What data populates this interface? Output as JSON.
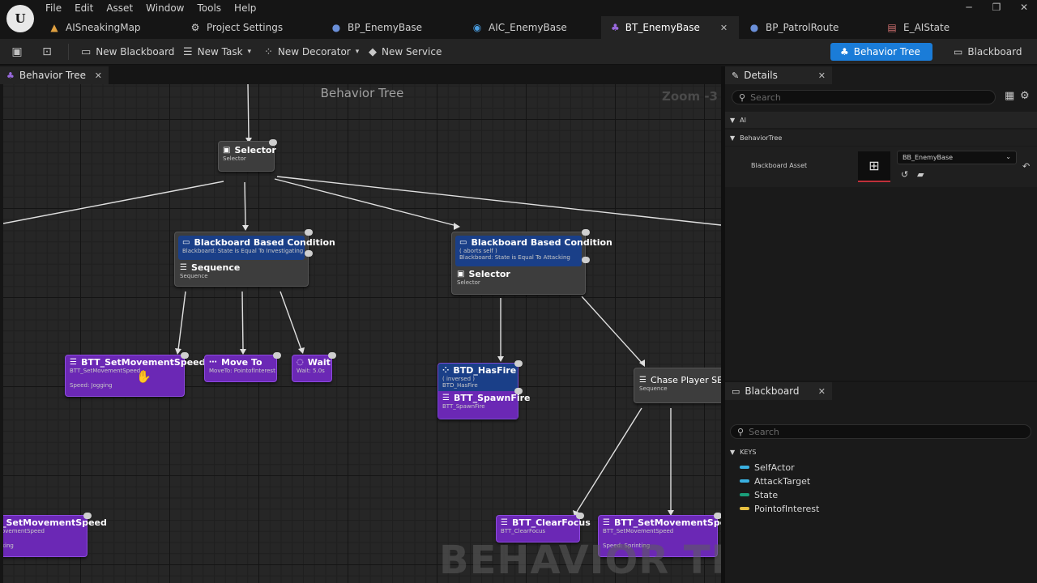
{
  "menu": [
    "File",
    "Edit",
    "Asset",
    "Window",
    "Tools",
    "Help"
  ],
  "tabs": [
    {
      "label": "AISneakingMap",
      "icon": "level-icon",
      "color": "#e0a040"
    },
    {
      "label": "Project Settings",
      "icon": "gear-icon",
      "color": "#c8c8c8"
    },
    {
      "label": "BP_EnemyBase",
      "icon": "person-icon",
      "color": "#6a8fd8"
    },
    {
      "label": "AIC_EnemyBase",
      "icon": "ai-controller-icon",
      "color": "#4a9de0"
    },
    {
      "label": "BT_EnemyBase",
      "icon": "behavior-tree-icon",
      "color": "#9a6ae0"
    },
    {
      "label": "BP_PatrolRoute",
      "icon": "person-icon",
      "color": "#6a8fd8"
    },
    {
      "label": "E_AIState",
      "icon": "enum-icon",
      "color": "#d07070"
    }
  ],
  "active_tab": "BT_EnemyBase",
  "toolbar": {
    "new_blackboard": "New Blackboard",
    "new_task": "New Task",
    "new_decorator": "New Decorator",
    "new_service": "New Service",
    "mode_behavior_tree": "Behavior Tree",
    "mode_blackboard": "Blackboard"
  },
  "graph": {
    "tab_label": "Behavior Tree",
    "title": "Behavior Tree",
    "zoom": "Zoom -3",
    "watermark": "BEHAVIOR TREE",
    "nodes": {
      "root_selector": {
        "title": "Selector",
        "sub": "Selector"
      },
      "left_decorator": {
        "title": "Blackboard Based Condition",
        "sub": "Blackboard: State is Equal To Investigating"
      },
      "left_sequence": {
        "title": "Sequence",
        "sub": "Sequence"
      },
      "mid_decorator": {
        "title": "Blackboard Based Condition",
        "sub1": "( aborts self )",
        "sub2": "Blackboard: State is Equal To Attacking"
      },
      "mid_selector": {
        "title": "Selector",
        "sub": "Selector"
      },
      "set_speed_1": {
        "title": "BTT_SetMovementSpeed",
        "sub": "BTT_SetMovementSpeed",
        "sub2": "Speed: Jogging"
      },
      "move_to": {
        "title": "Move To",
        "sub": "MoveTo: PointofInterest"
      },
      "wait": {
        "title": "Wait",
        "sub": "Wait: 5.0s"
      },
      "has_fire": {
        "title": "BTD_HasFire",
        "sub1": "( inversed )",
        "sub2": "BTD_HasFire"
      },
      "spawn_fire": {
        "title": "BTT_SpawnFire",
        "sub": "BTT_SpawnFire"
      },
      "chase_seq": {
        "title": "Chase Player SEQ",
        "sub": "Sequence"
      },
      "set_speed_left": {
        "title": "_SetMovementSpeed",
        "sub": "ovementSpeed",
        "sub2": "king"
      },
      "clear_focus": {
        "title": "BTT_ClearFocus",
        "sub": "BTT_ClearFocus"
      },
      "set_speed_2": {
        "title": "BTT_SetMovementSpeed",
        "sub": "BTT_SetMovementSpeed",
        "sub2": "Speed: Sprinting"
      }
    }
  },
  "details": {
    "tab_label": "Details",
    "search_placeholder": "Search",
    "section_ai": "AI",
    "section_bt": "BehaviorTree",
    "prop_label": "Blackboard Asset",
    "prop_value": "BB_EnemyBase"
  },
  "blackboard": {
    "tab_label": "Blackboard",
    "search_placeholder": "Search",
    "keys_header": "KEYS",
    "keys": [
      {
        "name": "SelfActor",
        "color": "#3ab0e0"
      },
      {
        "name": "AttackTarget",
        "color": "#3ab0e0"
      },
      {
        "name": "State",
        "color": "#1a9e7a"
      },
      {
        "name": "PointofInterest",
        "color": "#e8c040"
      }
    ]
  }
}
